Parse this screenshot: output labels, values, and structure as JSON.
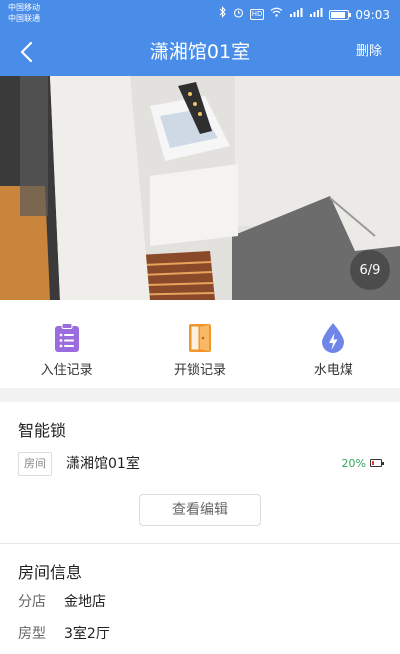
{
  "status_bar": {
    "carrier_1": "中国移动",
    "carrier_2": "中国联通",
    "network_hd": "HD",
    "network_1": "4G",
    "network_2": "2G",
    "battery_level": 0.85,
    "time": "09:03"
  },
  "navbar": {
    "title": "潇湘馆01室",
    "delete_label": "删除",
    "back_icon": "chevron-left-icon"
  },
  "photo": {
    "current_page": 6,
    "total_pages": 9,
    "indicator": "6/9"
  },
  "actions": [
    {
      "label": "入住记录",
      "icon": "clipboard-list-icon",
      "color": "#9b6be0"
    },
    {
      "label": "开锁记录",
      "icon": "door-icon",
      "color": "#f0962a"
    },
    {
      "label": "水电煤",
      "icon": "energy-drop-icon",
      "color": "#6f86e8"
    }
  ],
  "smart_lock": {
    "section_title": "智能锁",
    "room_tag": "房间",
    "lock_name": "潇湘馆01室",
    "battery_text": "20%",
    "battery_level": 0.2,
    "battery_text_color": "#3aa35f",
    "battery_fill_color": "#e53935",
    "view_edit_label": "查看编辑"
  },
  "room_info": {
    "section_title": "房间信息",
    "rows": [
      {
        "label": "分店",
        "value": "金地店"
      },
      {
        "label": "房型",
        "value": "3室2厅"
      }
    ]
  },
  "colors": {
    "primary": "#4a8de8",
    "background_gap": "#f2f2f2"
  }
}
